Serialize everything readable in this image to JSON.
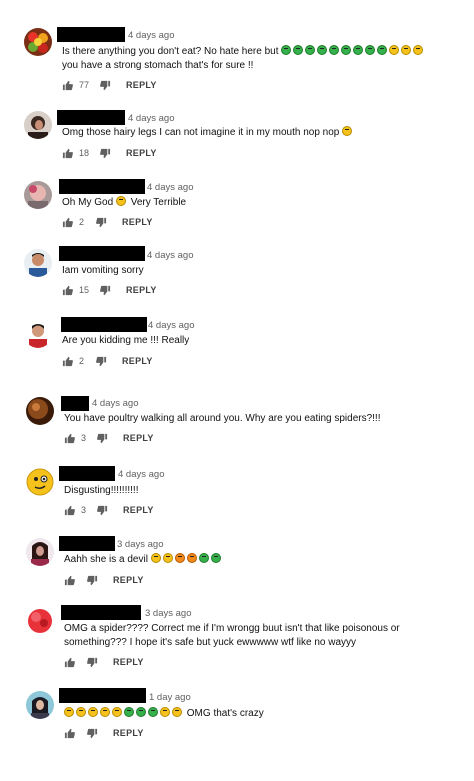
{
  "reply_label": "REPLY",
  "comments": [
    {
      "avatar": "avatar-fruit",
      "time": "4 days ago",
      "text_a": "Is there anything you don't eat? No hate here but",
      "emoji_a": [
        "nausea",
        "nausea",
        "nausea",
        "nausea",
        "nausea",
        "nausea",
        "nausea",
        "nausea",
        "nausea",
        "weary",
        "weary",
        "weary"
      ],
      "text_b": "you have a strong stomach that's for sure !!",
      "likes": "77"
    },
    {
      "avatar": "avatar-person",
      "time": "4 days ago",
      "text_a": "Omg those hairy legs I can not imagine it in my mouth nop nop",
      "emoji_a": [
        "weary"
      ],
      "likes": "18"
    },
    {
      "avatar": "avatar-person",
      "time": "4 days ago",
      "text_a": "Oh My God",
      "emoji_a": [
        "scream"
      ],
      "text_a2": "Very Terrible",
      "likes": "2"
    },
    {
      "avatar": "avatar-person",
      "time": "4 days ago",
      "text_a": "Iam vomiting sorry",
      "likes": "15"
    },
    {
      "avatar": "avatar-person",
      "time": "4 days ago",
      "text_a": "Are you kidding me !!! Really",
      "likes": "2"
    },
    {
      "avatar": "avatar-person",
      "time": "4 days ago",
      "text_a": "You have poultry walking all around you. Why are you eating spiders?!!!",
      "likes": "3"
    },
    {
      "avatar": "avatar-emoji",
      "time": "4 days ago",
      "text_a": "Disgusting!!!!!!!!!!",
      "likes": "3"
    },
    {
      "avatar": "avatar-person",
      "time": "3 days ago",
      "text_a": "Aahh she is a devil",
      "emoji_a": [
        "scream",
        "scream",
        "angry",
        "angry",
        "nausea",
        "nausea"
      ],
      "likes": ""
    },
    {
      "avatar": "avatar-flower",
      "time": "3 days ago",
      "text_a": "OMG a spider???? Correct me if I'm wrongg buut isn't that like poisonous or",
      "text_b": "something??? I hope it's safe but yuck ewwwww wtf like no wayyy",
      "likes": ""
    },
    {
      "avatar": "avatar-person",
      "time": "1 day ago",
      "emoji_a": [
        "weary",
        "weary",
        "weary",
        "weary",
        "weary",
        "nausea",
        "nausea",
        "nausea",
        "weary",
        "weary"
      ],
      "text_a2": "OMG that's crazy",
      "likes": ""
    }
  ]
}
